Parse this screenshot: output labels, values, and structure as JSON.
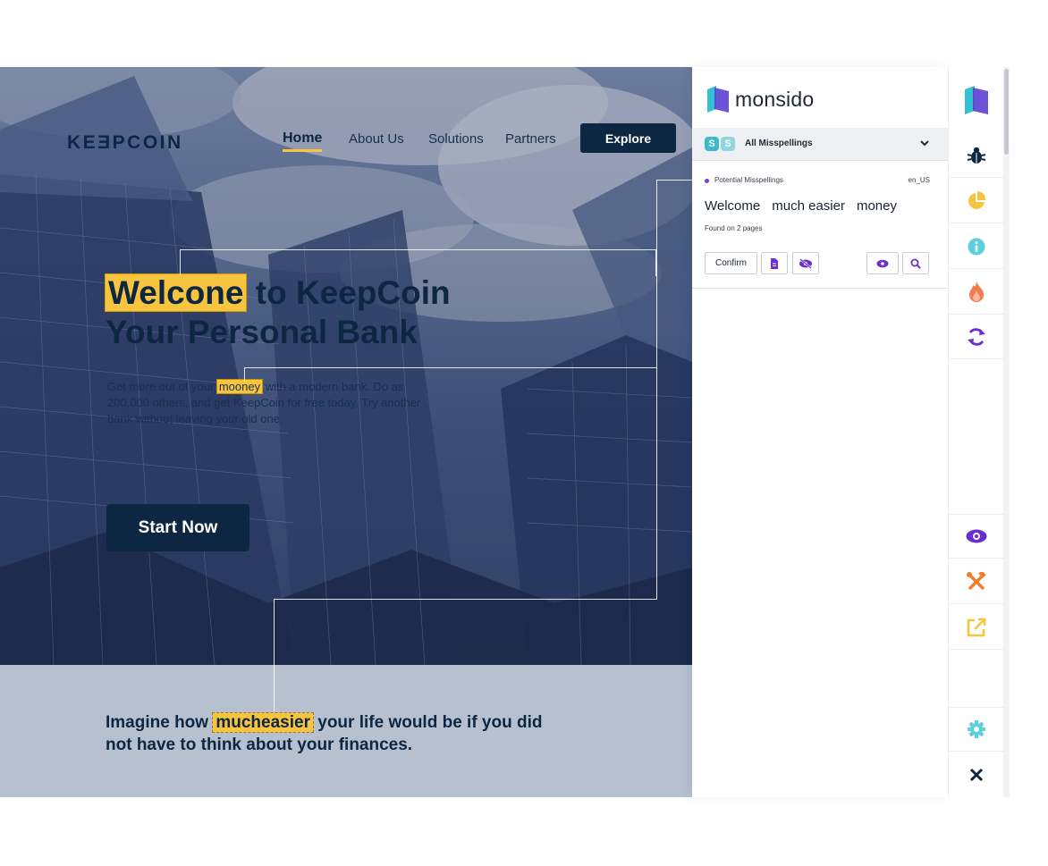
{
  "site": {
    "logo": "KEƎPCOIN",
    "nav": [
      {
        "label": "Home"
      },
      {
        "label": "About Us"
      },
      {
        "label": "Solutions"
      },
      {
        "label": "Partners"
      }
    ],
    "explore_label": "Explore",
    "headline": {
      "word_highlighted": "Welcone",
      "rest_line1": " to KeepCoin",
      "line2": "Your Personal Bank"
    },
    "sub": {
      "before": "Get more out of your ",
      "highlight": "mooney",
      "after": " with a modern bank. Do as 200,000 others, and get KeepCoin for free today. Try another bank without leaving your old one."
    },
    "start_label": "Start Now",
    "lower": {
      "before": "Imagine how ",
      "highlight": "mucheasier",
      "after": " your life would be if you did not have to think about your finances."
    },
    "highlight_color": "#f6c43f",
    "brand_navy": "#0d2742"
  },
  "panel": {
    "brand_name": "monsido",
    "filter": {
      "label": "All Misspellings"
    },
    "card": {
      "category": "Potential Misspellings",
      "language": "en_US",
      "words": [
        "Welcome",
        "much easier",
        "money"
      ],
      "found": "Found on 2 pages",
      "confirm_label": "Confirm"
    }
  },
  "rail": {
    "icons": [
      "monsido-logo-icon",
      "bug-icon",
      "pie-chart-icon",
      "info-icon",
      "flame-icon",
      "refresh-icon",
      "eye-icon",
      "tools-icon",
      "external-link-icon",
      "gear-icon",
      "close-icon"
    ]
  }
}
